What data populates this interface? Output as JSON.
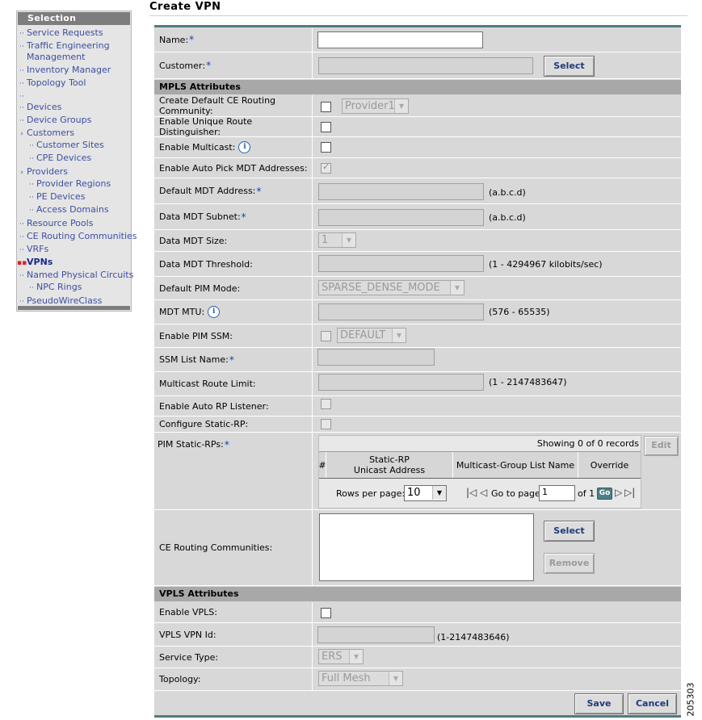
{
  "sidebar": {
    "header": "Selection",
    "items": [
      {
        "label": "Service Requests"
      },
      {
        "label": "Traffic Engineering"
      },
      {
        "label": "Management"
      },
      {
        "label": "Inventory Manager"
      },
      {
        "label": "Topology Tool"
      },
      {
        "label": ""
      },
      {
        "label": "Devices"
      },
      {
        "label": "Device Groups"
      },
      {
        "label": "Customers"
      },
      {
        "label": "Customer Sites"
      },
      {
        "label": "CPE Devices"
      },
      {
        "label": "Providers"
      },
      {
        "label": "Provider Regions"
      },
      {
        "label": "PE Devices"
      },
      {
        "label": "Access Domains"
      },
      {
        "label": "Resource Pools"
      },
      {
        "label": "CE Routing Communities"
      },
      {
        "label": "VRFs"
      },
      {
        "label": "VPNs"
      },
      {
        "label": "Named Physical Circuits"
      },
      {
        "label": "NPC Rings"
      },
      {
        "label": "PseudoWireClass"
      }
    ]
  },
  "page": {
    "title": "Create VPN"
  },
  "form": {
    "name_label": "Name",
    "customer_label": "Customer",
    "select_button": "Select",
    "mpls_header": "MPLS Attributes",
    "create_default_ce_label": "Create Default CE Routing Community:",
    "create_default_ce_select": "Provider1",
    "unique_rd_label": "Enable Unique Route Distinguisher:",
    "multicast_label": "Enable Multicast:",
    "auto_pick_mdt_label": "Enable Auto Pick MDT Addresses:",
    "default_mdt_label": "Default MDT Address",
    "abcd_hint": "(a.b.c.d)",
    "data_mdt_subnet_label": "Data MDT Subnet",
    "data_mdt_size_label": "Data MDT Size:",
    "data_mdt_size_value": "1",
    "data_mdt_threshold_label": "Data MDT Threshold:",
    "data_mdt_threshold_hint": "(1 - 4294967 kilobits/sec)",
    "default_pim_mode_label": "Default PIM Mode:",
    "default_pim_mode_value": "SPARSE_DENSE_MODE",
    "mdt_mtu_label": "MDT MTU:",
    "mdt_mtu_hint": "(576 - 65535)",
    "pim_ssm_label": "Enable PIM SSM:",
    "pim_ssm_value": "DEFAULT",
    "ssm_list_label": "SSM List Name",
    "mroute_limit_label": "Multicast Route Limit:",
    "mroute_limit_hint": "(1 - 2147483647)",
    "auto_rp_label": "Enable Auto RP Listener:",
    "static_rp_label": "Configure Static-RP:",
    "pim_static_rps_label": "PIM Static-RPs",
    "pim_table": {
      "records": "Showing 0 of 0 records",
      "edit_button": "Edit",
      "col_hash": "#",
      "col_static_rp_1": "Static-RP",
      "col_static_rp_2": "Unicast Address",
      "col_mcast_group": "Multicast-Group List Name",
      "col_override": "Override",
      "rows_per_page_label": "Rows per page:",
      "rows_per_page_value": "10",
      "goto_label": "Go to page:",
      "goto_value": "1",
      "of_label": "of 1",
      "go_button": "Go"
    },
    "ce_rc_label": "CE Routing Communities:",
    "remove_button": "Remove",
    "vpls_header": "VPLS Attributes",
    "enable_vpls_label": "Enable VPLS:",
    "vpls_id_label": "VPLS VPN Id:",
    "vpls_id_hint": "(1-2147483646)",
    "service_type_label": "Service Type:",
    "service_type_value": "ERS",
    "topology_label": "Topology:",
    "topology_value": "Full Mesh",
    "save_button": "Save",
    "cancel_button": "Cancel"
  },
  "figure_number": "205303",
  "colors": {
    "link": "#3c4fa3",
    "required_asterisk": "#1040c0",
    "form_border": "#4f7b80"
  }
}
